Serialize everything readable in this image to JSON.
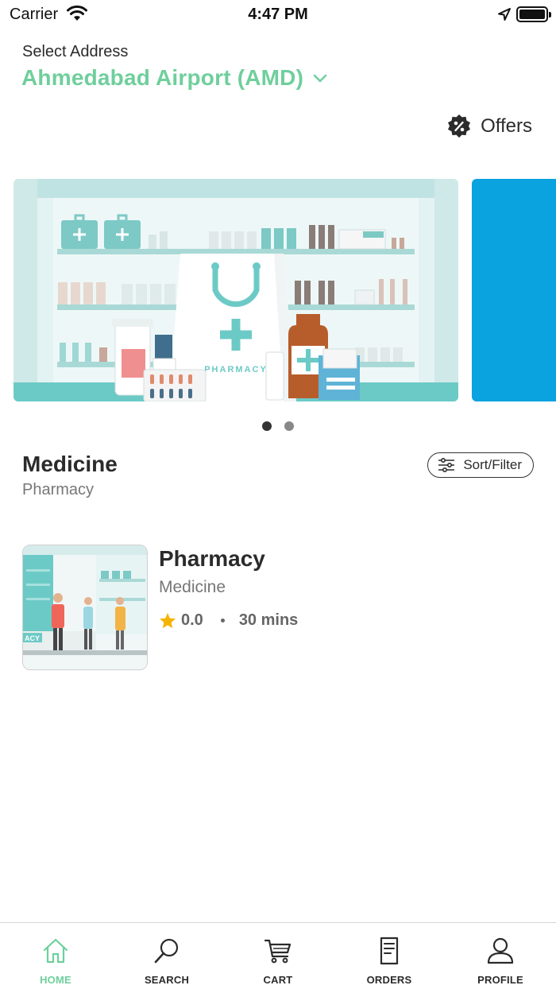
{
  "status_bar": {
    "carrier": "Carrier",
    "time": "4:47 PM",
    "battery_level": 1.0
  },
  "address": {
    "label": "Select Address",
    "value": "Ahmedabad Airport (AMD)"
  },
  "offers": {
    "label": "Offers",
    "icon": "offer-badge-icon"
  },
  "banner": {
    "text": "PHARMACY",
    "page_count": 2,
    "active_page": 1
  },
  "section": {
    "title": "Medicine",
    "subtitle": "Pharmacy",
    "sort_filter_label": "Sort/Filter"
  },
  "stores": [
    {
      "name": "Pharmacy",
      "category": "Medicine",
      "rating": "0.0",
      "delivery_time": "30 mins",
      "thumb_text": "ACY"
    }
  ],
  "bottom_nav": {
    "items": [
      {
        "label": "HOME",
        "icon": "home-icon",
        "active": true
      },
      {
        "label": "SEARCH",
        "icon": "search-icon",
        "active": false
      },
      {
        "label": "CART",
        "icon": "cart-icon",
        "active": false
      },
      {
        "label": "ORDERS",
        "icon": "orders-icon",
        "active": false
      },
      {
        "label": "PROFILE",
        "icon": "profile-icon",
        "active": false
      }
    ]
  },
  "colors": {
    "accent": "#6fcf9c",
    "text": "#2b2b2b",
    "muted": "#777777",
    "banner_teal": "#6ccac6",
    "banner_blue": "#0aa2df",
    "star": "#f5b400"
  }
}
